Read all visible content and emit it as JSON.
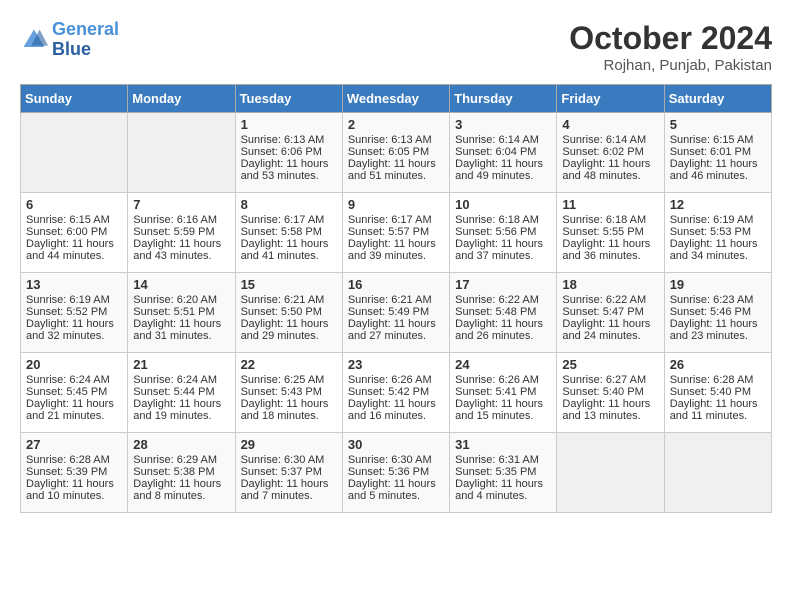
{
  "header": {
    "logo": {
      "line1": "General",
      "line2": "Blue"
    },
    "title": "October 2024",
    "subtitle": "Rojhan, Punjab, Pakistan"
  },
  "days_of_week": [
    "Sunday",
    "Monday",
    "Tuesday",
    "Wednesday",
    "Thursday",
    "Friday",
    "Saturday"
  ],
  "weeks": [
    [
      {
        "day": "",
        "empty": true
      },
      {
        "day": "",
        "empty": true
      },
      {
        "day": "1",
        "sunrise": "6:13 AM",
        "sunset": "6:06 PM",
        "daylight": "11 hours and 53 minutes."
      },
      {
        "day": "2",
        "sunrise": "6:13 AM",
        "sunset": "6:05 PM",
        "daylight": "11 hours and 51 minutes."
      },
      {
        "day": "3",
        "sunrise": "6:14 AM",
        "sunset": "6:04 PM",
        "daylight": "11 hours and 49 minutes."
      },
      {
        "day": "4",
        "sunrise": "6:14 AM",
        "sunset": "6:02 PM",
        "daylight": "11 hours and 48 minutes."
      },
      {
        "day": "5",
        "sunrise": "6:15 AM",
        "sunset": "6:01 PM",
        "daylight": "11 hours and 46 minutes."
      }
    ],
    [
      {
        "day": "6",
        "sunrise": "6:15 AM",
        "sunset": "6:00 PM",
        "daylight": "11 hours and 44 minutes."
      },
      {
        "day": "7",
        "sunrise": "6:16 AM",
        "sunset": "5:59 PM",
        "daylight": "11 hours and 43 minutes."
      },
      {
        "day": "8",
        "sunrise": "6:17 AM",
        "sunset": "5:58 PM",
        "daylight": "11 hours and 41 minutes."
      },
      {
        "day": "9",
        "sunrise": "6:17 AM",
        "sunset": "5:57 PM",
        "daylight": "11 hours and 39 minutes."
      },
      {
        "day": "10",
        "sunrise": "6:18 AM",
        "sunset": "5:56 PM",
        "daylight": "11 hours and 37 minutes."
      },
      {
        "day": "11",
        "sunrise": "6:18 AM",
        "sunset": "5:55 PM",
        "daylight": "11 hours and 36 minutes."
      },
      {
        "day": "12",
        "sunrise": "6:19 AM",
        "sunset": "5:53 PM",
        "daylight": "11 hours and 34 minutes."
      }
    ],
    [
      {
        "day": "13",
        "sunrise": "6:19 AM",
        "sunset": "5:52 PM",
        "daylight": "11 hours and 32 minutes."
      },
      {
        "day": "14",
        "sunrise": "6:20 AM",
        "sunset": "5:51 PM",
        "daylight": "11 hours and 31 minutes."
      },
      {
        "day": "15",
        "sunrise": "6:21 AM",
        "sunset": "5:50 PM",
        "daylight": "11 hours and 29 minutes."
      },
      {
        "day": "16",
        "sunrise": "6:21 AM",
        "sunset": "5:49 PM",
        "daylight": "11 hours and 27 minutes."
      },
      {
        "day": "17",
        "sunrise": "6:22 AM",
        "sunset": "5:48 PM",
        "daylight": "11 hours and 26 minutes."
      },
      {
        "day": "18",
        "sunrise": "6:22 AM",
        "sunset": "5:47 PM",
        "daylight": "11 hours and 24 minutes."
      },
      {
        "day": "19",
        "sunrise": "6:23 AM",
        "sunset": "5:46 PM",
        "daylight": "11 hours and 23 minutes."
      }
    ],
    [
      {
        "day": "20",
        "sunrise": "6:24 AM",
        "sunset": "5:45 PM",
        "daylight": "11 hours and 21 minutes."
      },
      {
        "day": "21",
        "sunrise": "6:24 AM",
        "sunset": "5:44 PM",
        "daylight": "11 hours and 19 minutes."
      },
      {
        "day": "22",
        "sunrise": "6:25 AM",
        "sunset": "5:43 PM",
        "daylight": "11 hours and 18 minutes."
      },
      {
        "day": "23",
        "sunrise": "6:26 AM",
        "sunset": "5:42 PM",
        "daylight": "11 hours and 16 minutes."
      },
      {
        "day": "24",
        "sunrise": "6:26 AM",
        "sunset": "5:41 PM",
        "daylight": "11 hours and 15 minutes."
      },
      {
        "day": "25",
        "sunrise": "6:27 AM",
        "sunset": "5:40 PM",
        "daylight": "11 hours and 13 minutes."
      },
      {
        "day": "26",
        "sunrise": "6:28 AM",
        "sunset": "5:40 PM",
        "daylight": "11 hours and 11 minutes."
      }
    ],
    [
      {
        "day": "27",
        "sunrise": "6:28 AM",
        "sunset": "5:39 PM",
        "daylight": "11 hours and 10 minutes."
      },
      {
        "day": "28",
        "sunrise": "6:29 AM",
        "sunset": "5:38 PM",
        "daylight": "11 hours and 8 minutes."
      },
      {
        "day": "29",
        "sunrise": "6:30 AM",
        "sunset": "5:37 PM",
        "daylight": "11 hours and 7 minutes."
      },
      {
        "day": "30",
        "sunrise": "6:30 AM",
        "sunset": "5:36 PM",
        "daylight": "11 hours and 5 minutes."
      },
      {
        "day": "31",
        "sunrise": "6:31 AM",
        "sunset": "5:35 PM",
        "daylight": "11 hours and 4 minutes."
      },
      {
        "day": "",
        "empty": true
      },
      {
        "day": "",
        "empty": true
      }
    ]
  ]
}
